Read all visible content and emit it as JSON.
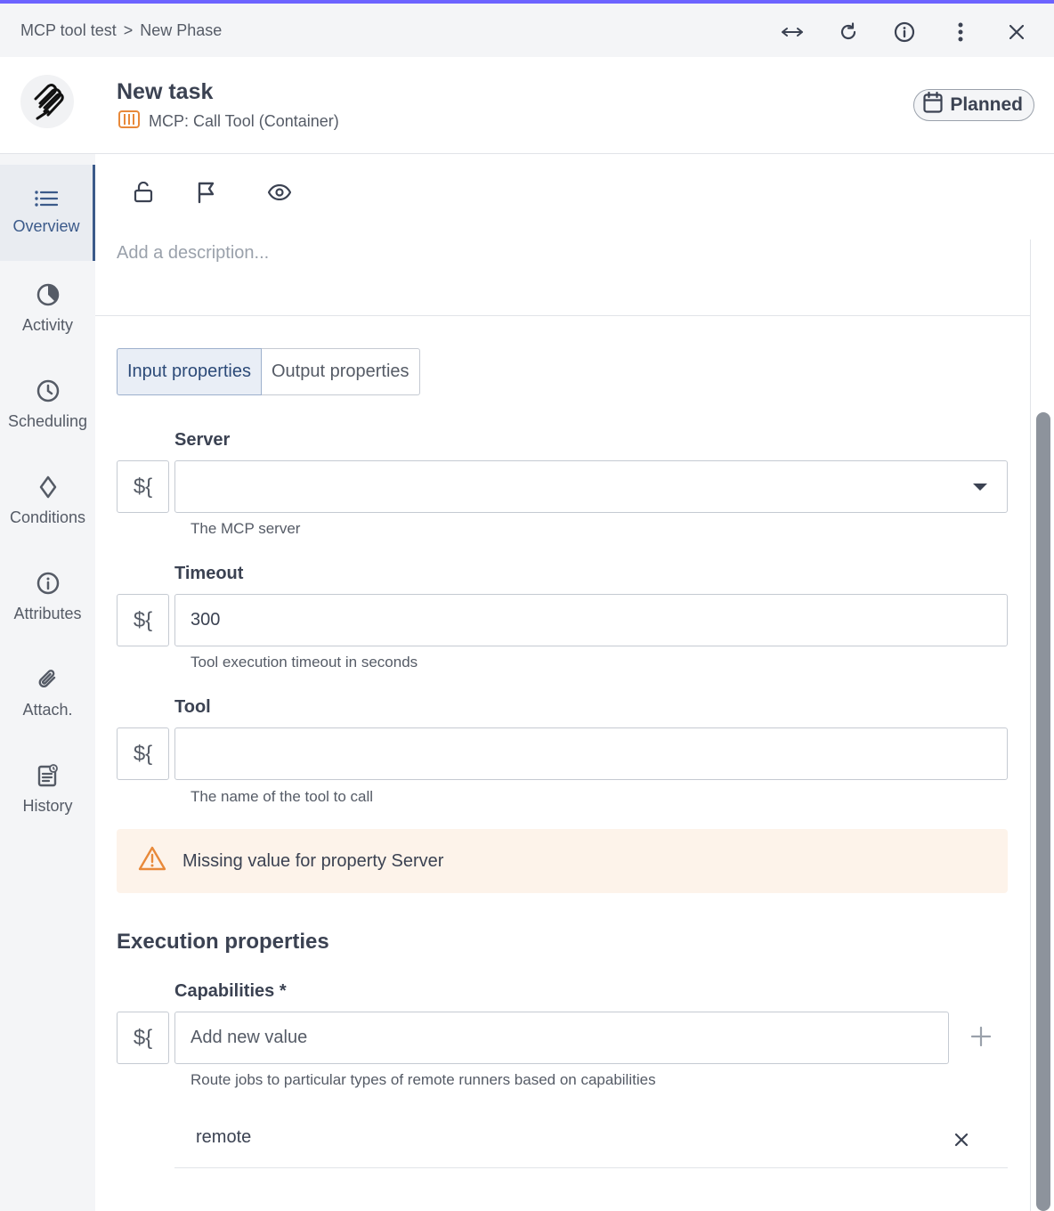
{
  "breadcrumb": {
    "project": "MCP tool test",
    "separator": ">",
    "phase": "New Phase"
  },
  "window_icons": [
    "expand-icon",
    "refresh-icon",
    "info-icon",
    "more-vertical-icon",
    "close-icon"
  ],
  "task": {
    "title": "New task",
    "type_label": "MCP: Call Tool (Container)",
    "status": "Planned"
  },
  "sidebar": {
    "items": [
      {
        "label": "Overview",
        "icon": "list-icon",
        "active": true
      },
      {
        "label": "Activity",
        "icon": "pie-icon"
      },
      {
        "label": "Scheduling",
        "icon": "clock-icon"
      },
      {
        "label": "Conditions",
        "icon": "diamond-icon"
      },
      {
        "label": "Attributes",
        "icon": "info-icon"
      },
      {
        "label": "Attach.",
        "icon": "paperclip-icon"
      },
      {
        "label": "History",
        "icon": "clipboard-icon"
      }
    ]
  },
  "toolbar": {
    "icons": [
      "lock-icon",
      "flag-icon",
      "eye-icon"
    ]
  },
  "description": {
    "placeholder": "Add a description..."
  },
  "tabs": {
    "input": "Input properties",
    "output": "Output properties"
  },
  "expr_label": "${",
  "fields": {
    "server": {
      "label": "Server",
      "value": "",
      "help": "The MCP server"
    },
    "timeout": {
      "label": "Timeout",
      "value": "300",
      "help": "Tool execution timeout in seconds"
    },
    "tool": {
      "label": "Tool",
      "value": "",
      "help": "The name of the tool to call"
    }
  },
  "warning": {
    "text": "Missing value for property Server"
  },
  "execution": {
    "title": "Execution properties",
    "capabilities": {
      "label": "Capabilities *",
      "placeholder": "Add new value",
      "help": "Route jobs to particular types of remote runners based on capabilities",
      "values": [
        "remote"
      ]
    }
  },
  "colors": {
    "accent": "#6c63ff",
    "active_nav": "#3b5a8a",
    "warning_bg": "#fdf3ea",
    "warning_icon": "#e8893a",
    "container_icon": "#e8893a"
  }
}
